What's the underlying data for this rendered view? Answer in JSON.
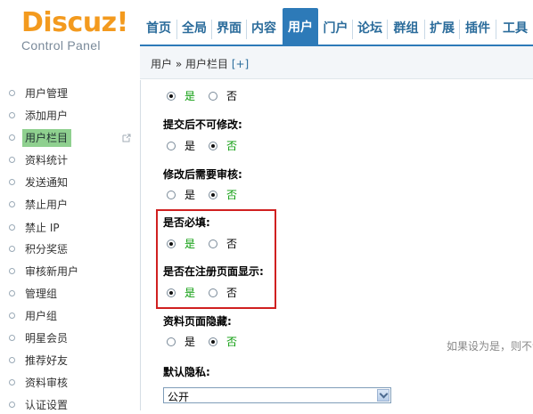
{
  "logo": {
    "brand": "Discuz!",
    "subtitle": "Control Panel"
  },
  "nav": [
    {
      "label": "首页",
      "active": false
    },
    {
      "label": "全局",
      "active": false
    },
    {
      "label": "界面",
      "active": false
    },
    {
      "label": "内容",
      "active": false
    },
    {
      "label": "用户",
      "active": true
    },
    {
      "label": "门户",
      "active": false
    },
    {
      "label": "论坛",
      "active": false
    },
    {
      "label": "群组",
      "active": false
    },
    {
      "label": "扩展",
      "active": false
    },
    {
      "label": "插件",
      "active": false
    },
    {
      "label": "工具",
      "active": false
    }
  ],
  "breadcrumb": {
    "text": "用户 » 用户栏目",
    "add": "[+]"
  },
  "sidebar": {
    "items": [
      {
        "label": "用户管理"
      },
      {
        "label": "添加用户"
      },
      {
        "label": "用户栏目",
        "active": true
      },
      {
        "label": "资料统计"
      },
      {
        "label": "发送通知"
      },
      {
        "label": "禁止用户"
      },
      {
        "label": "禁止 IP"
      },
      {
        "label": "积分奖惩"
      },
      {
        "label": "审核新用户"
      },
      {
        "label": "管理组"
      },
      {
        "label": "用户组"
      },
      {
        "label": "明星会员"
      },
      {
        "label": "推荐好友"
      },
      {
        "label": "资料审核"
      },
      {
        "label": "认证设置"
      }
    ]
  },
  "form": {
    "yes": "是",
    "no": "否",
    "first_row_selected": "yes",
    "q_submit_readonly": "提交后不可修改:",
    "q_submit_readonly_selected": "no",
    "q_need_review": "修改后需要审核:",
    "q_need_review_selected": "no",
    "q_required": "是否必填:",
    "q_required_selected": "yes",
    "q_show_on_register": "是否在注册页面显示:",
    "q_show_on_register_selected": "yes",
    "q_hide_profile": "资料页面隐藏:",
    "q_hide_profile_selected": "no",
    "hint": "如果设为是，则不该",
    "q_default_privacy": "默认隐私:",
    "privacy_value": "公开"
  },
  "colors": {
    "accent": "#2d7ab8",
    "brand": "#f39a1e",
    "selected_text": "#0a9b0a",
    "highlight": "#d02020"
  }
}
